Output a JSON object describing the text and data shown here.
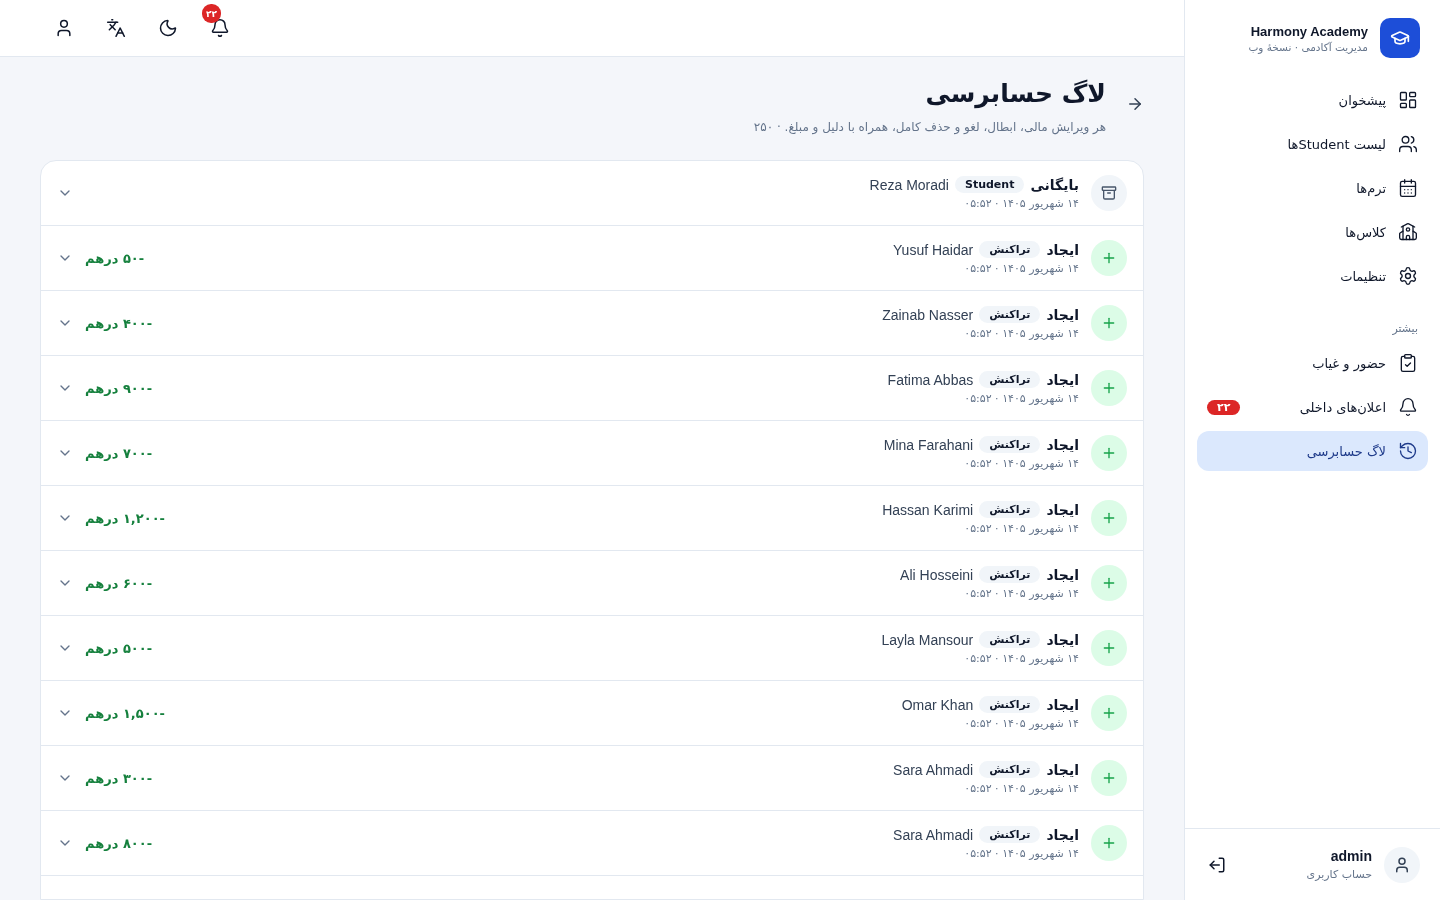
{
  "sidebar": {
    "brand": {
      "title": "Harmony Academy",
      "subtitle": "مدیریت آکادمی · نسخهٔ وب"
    },
    "items": [
      {
        "label": "پیشخوان",
        "selected": false
      },
      {
        "label": "لیست Studentها",
        "selected": false
      },
      {
        "label": "ترم‌ها",
        "selected": false
      },
      {
        "label": "کلاس‌ها",
        "selected": false
      },
      {
        "label": "تنظیمات",
        "selected": false
      }
    ],
    "section_label": "بیشتر",
    "more_items": [
      {
        "label": "حضور و غیاب",
        "selected": false
      },
      {
        "label": "اعلان‌های داخلی",
        "selected": false,
        "badge": "۲۲"
      },
      {
        "label": "لاگ حسابرسی",
        "selected": true
      }
    ],
    "user": {
      "name": "admin",
      "role": "حساب کاربری"
    }
  },
  "topbar": {
    "notification_badge": "۲۲"
  },
  "page": {
    "title": "لاگ حسابرسی",
    "subtitle": "هر ویرایش مالی، ابطال، لغو و حذف کامل، همراه با دلیل و مبلغ. · ۲۵۰"
  },
  "entries": [
    {
      "kind": "archive",
      "action": "بایگانی",
      "tag": "Student",
      "name": "Reza Moradi",
      "date": "۱۴ شهریور ۱۴۰۵ · ۰۵:۵۲"
    },
    {
      "kind": "create",
      "action": "ایجاد",
      "tag": "تراکنش",
      "name": "Yusuf Haidar",
      "date": "۱۴ شهریور ۱۴۰۵ · ۰۵:۵۲",
      "amount": "-۵۰ درهم"
    },
    {
      "kind": "create",
      "action": "ایجاد",
      "tag": "تراکنش",
      "name": "Zainab Nasser",
      "date": "۱۴ شهریور ۱۴۰۵ · ۰۵:۵۲",
      "amount": "-۴۰۰ درهم"
    },
    {
      "kind": "create",
      "action": "ایجاد",
      "tag": "تراکنش",
      "name": "Fatima Abbas",
      "date": "۱۴ شهریور ۱۴۰۵ · ۰۵:۵۲",
      "amount": "-۹۰۰ درهم"
    },
    {
      "kind": "create",
      "action": "ایجاد",
      "tag": "تراکنش",
      "name": "Mina Farahani",
      "date": "۱۴ شهریور ۱۴۰۵ · ۰۵:۵۲",
      "amount": "-۷۰۰ درهم"
    },
    {
      "kind": "create",
      "action": "ایجاد",
      "tag": "تراکنش",
      "name": "Hassan Karimi",
      "date": "۱۴ شهریور ۱۴۰۵ · ۰۵:۵۲",
      "amount": "-۱,۲۰۰ درهم"
    },
    {
      "kind": "create",
      "action": "ایجاد",
      "tag": "تراکنش",
      "name": "Ali Hosseini",
      "date": "۱۴ شهریور ۱۴۰۵ · ۰۵:۵۲",
      "amount": "-۶۰۰ درهم"
    },
    {
      "kind": "create",
      "action": "ایجاد",
      "tag": "تراکنش",
      "name": "Layla Mansour",
      "date": "۱۴ شهریور ۱۴۰۵ · ۰۵:۵۲",
      "amount": "-۵۰۰ درهم"
    },
    {
      "kind": "create",
      "action": "ایجاد",
      "tag": "تراکنش",
      "name": "Omar Khan",
      "date": "۱۴ شهریور ۱۴۰۵ · ۰۵:۵۲",
      "amount": "-۱,۵۰۰ درهم"
    },
    {
      "kind": "create",
      "action": "ایجاد",
      "tag": "تراکنش",
      "name": "Sara Ahmadi",
      "date": "۱۴ شهریور ۱۴۰۵ · ۰۵:۵۲",
      "amount": "-۳۰۰ درهم"
    },
    {
      "kind": "create",
      "action": "ایجاد",
      "tag": "تراکنش",
      "name": "Sara Ahmadi",
      "date": "۱۴ شهریور ۱۴۰۵ · ۰۵:۵۲",
      "amount": "-۸۰۰ درهم"
    }
  ]
}
